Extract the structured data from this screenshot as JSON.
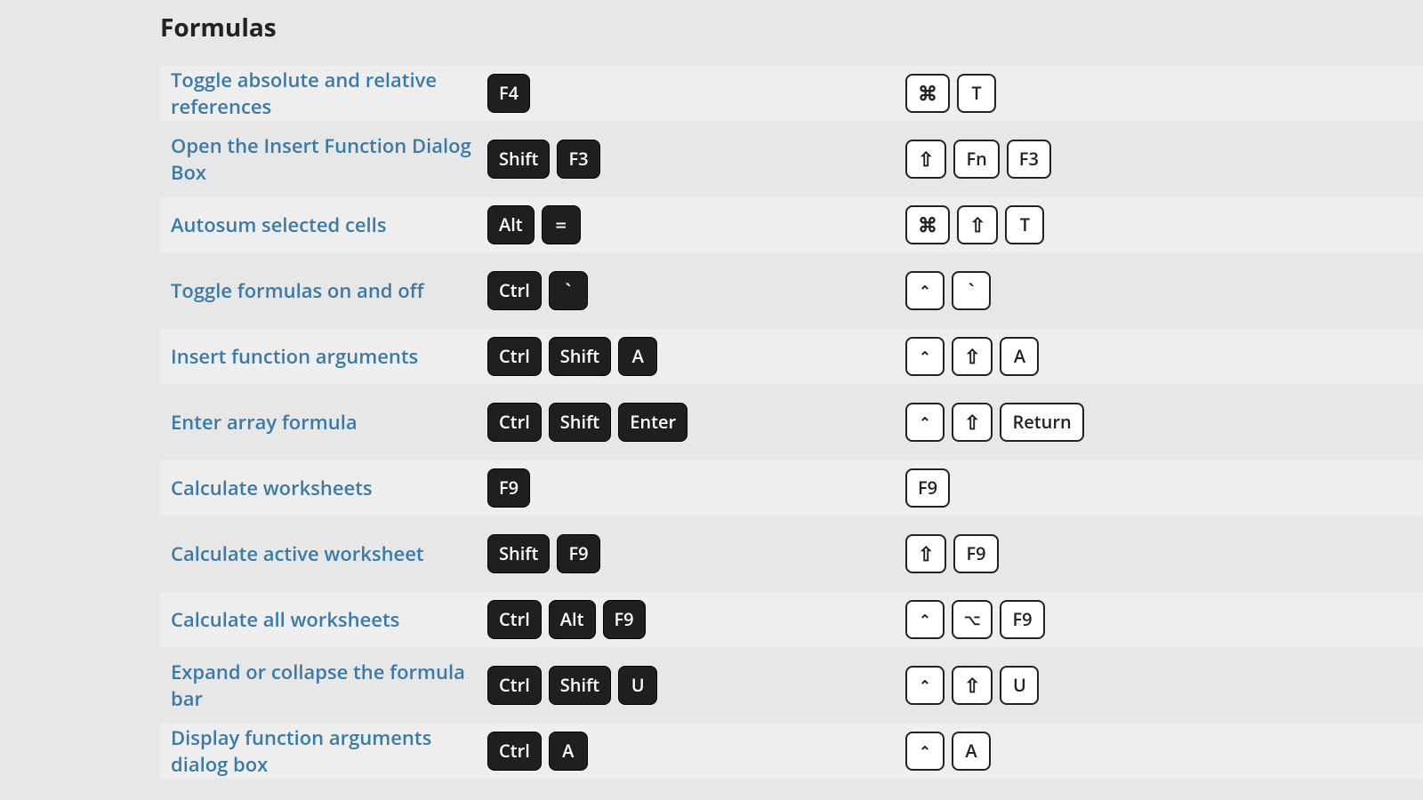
{
  "section_title": "Formulas",
  "rows": [
    {
      "desc": "Toggle absolute and relative references",
      "win": [
        "F4"
      ],
      "mac": [
        "⌘",
        "T"
      ]
    },
    {
      "desc": "Open the Insert Function Dialog Box",
      "win": [
        "Shift",
        "F3"
      ],
      "mac": [
        "⇧",
        "Fn",
        "F3"
      ]
    },
    {
      "desc": "Autosum selected cells",
      "win": [
        "Alt",
        "="
      ],
      "mac": [
        "⌘",
        "⇧",
        "T"
      ]
    },
    {
      "desc": "Toggle formulas on and off",
      "win": [
        "Ctrl",
        "`"
      ],
      "mac": [
        "⌃",
        "`"
      ]
    },
    {
      "desc": "Insert function arguments",
      "win": [
        "Ctrl",
        "Shift",
        "A"
      ],
      "mac": [
        "⌃",
        "⇧",
        "A"
      ]
    },
    {
      "desc": "Enter array formula",
      "win": [
        "Ctrl",
        "Shift",
        "Enter"
      ],
      "mac": [
        "⌃",
        "⇧",
        "Return"
      ]
    },
    {
      "desc": "Calculate worksheets",
      "win": [
        "F9"
      ],
      "mac": [
        "F9"
      ]
    },
    {
      "desc": "Calculate active worksheet",
      "win": [
        "Shift",
        "F9"
      ],
      "mac": [
        "⇧",
        "F9"
      ]
    },
    {
      "desc": "Calculate all worksheets",
      "win": [
        "Ctrl",
        "Alt",
        "F9"
      ],
      "mac": [
        "⌃",
        "⌥",
        "F9"
      ]
    },
    {
      "desc": "Expand or collapse the formula bar",
      "win": [
        "Ctrl",
        "Shift",
        "U"
      ],
      "mac": [
        "⌃",
        "⇧",
        "U"
      ]
    },
    {
      "desc": "Display function arguments dialog box",
      "win": [
        "Ctrl",
        "A"
      ],
      "mac": [
        "⌃",
        "A"
      ]
    }
  ],
  "symbol_keys": [
    "⌘",
    "⇧",
    "⌃",
    "⌥",
    "`",
    "="
  ],
  "small_symbol_keys": [
    "⌃",
    "⌥"
  ]
}
